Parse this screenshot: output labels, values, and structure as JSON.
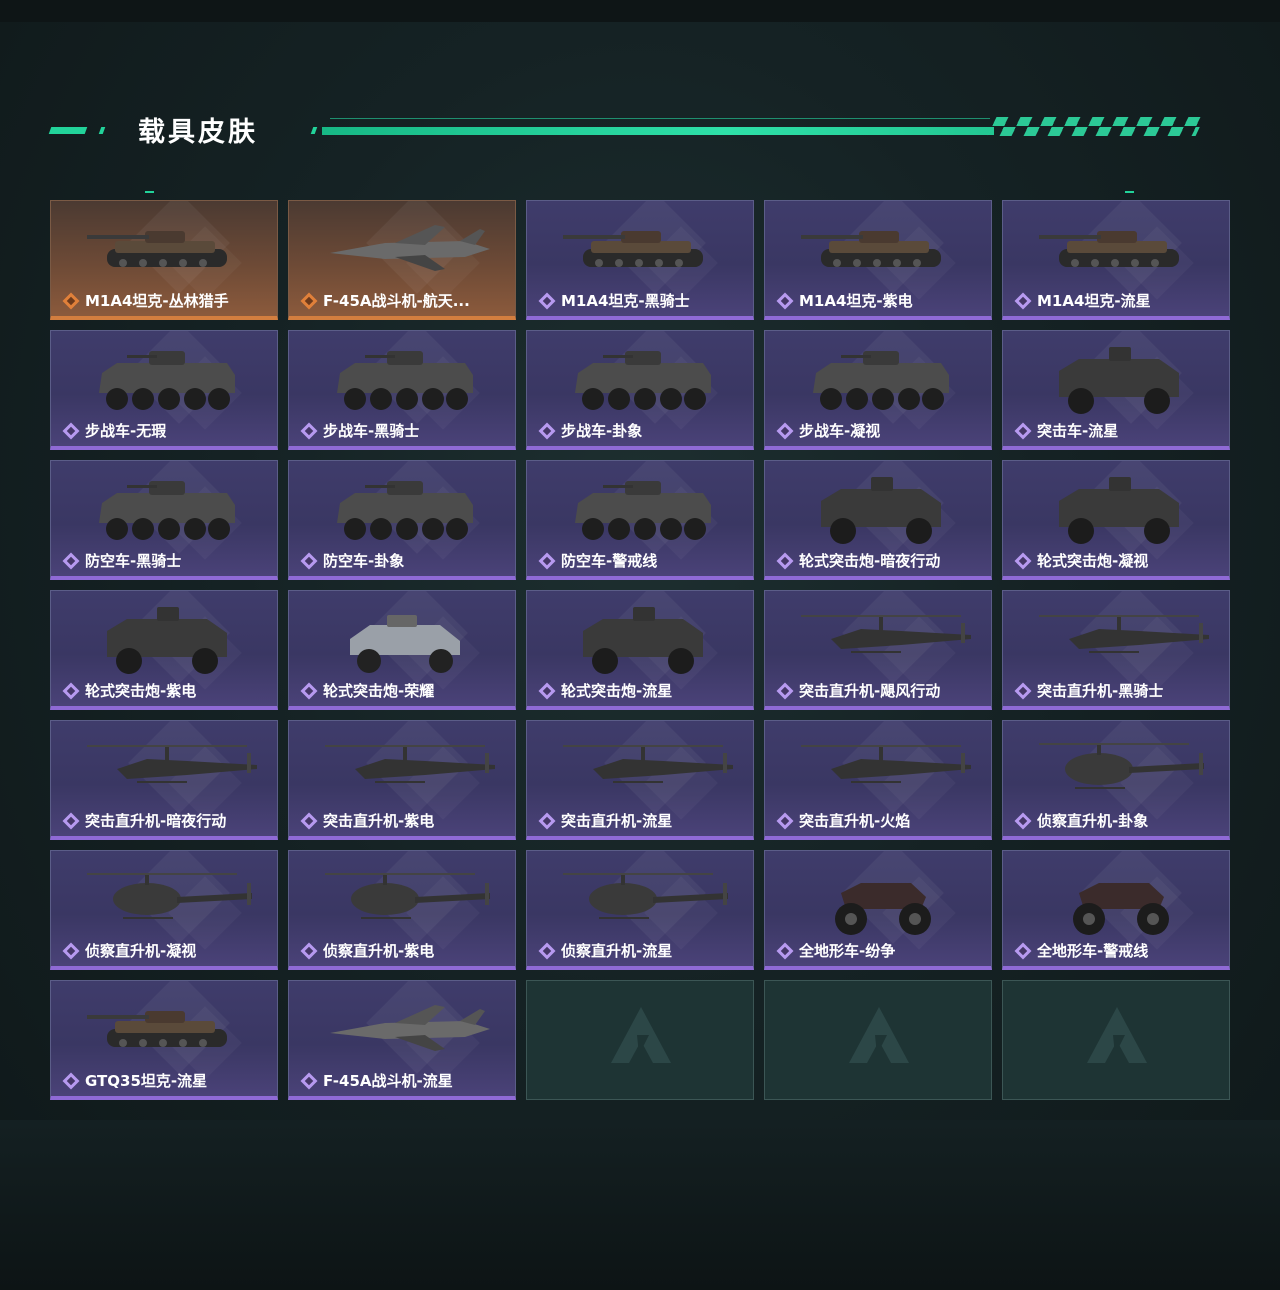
{
  "header": {
    "title": "载具皮肤"
  },
  "colors": {
    "accent": "#22d39a",
    "purple_rarity": "#8f6ad6",
    "orange_rarity": "#d37e3f"
  },
  "skins": [
    {
      "label": "M1A4坦克-丛林猎手",
      "rarity": "orange",
      "kind": "tank"
    },
    {
      "label": "F-45A战斗机-航天...",
      "rarity": "orange",
      "kind": "jet"
    },
    {
      "label": "M1A4坦克-黑骑士",
      "rarity": "purple",
      "kind": "tank"
    },
    {
      "label": "M1A4坦克-紫电",
      "rarity": "purple",
      "kind": "tank"
    },
    {
      "label": "M1A4坦克-流星",
      "rarity": "purple",
      "kind": "tank"
    },
    {
      "label": "步战车-无瑕",
      "rarity": "purple",
      "kind": "ifv"
    },
    {
      "label": "步战车-黑骑士",
      "rarity": "purple",
      "kind": "ifv"
    },
    {
      "label": "步战车-卦象",
      "rarity": "purple",
      "kind": "ifv"
    },
    {
      "label": "步战车-凝视",
      "rarity": "purple",
      "kind": "ifv"
    },
    {
      "label": "突击车-流星",
      "rarity": "purple",
      "kind": "truck"
    },
    {
      "label": "防空车-黑骑士",
      "rarity": "purple",
      "kind": "ifv"
    },
    {
      "label": "防空车-卦象",
      "rarity": "purple",
      "kind": "ifv"
    },
    {
      "label": "防空车-警戒线",
      "rarity": "purple",
      "kind": "ifv"
    },
    {
      "label": "轮式突击炮-暗夜行动",
      "rarity": "purple",
      "kind": "truck"
    },
    {
      "label": "轮式突击炮-凝视",
      "rarity": "purple",
      "kind": "truck"
    },
    {
      "label": "轮式突击炮-紫电",
      "rarity": "purple",
      "kind": "truck"
    },
    {
      "label": "轮式突击炮-荣耀",
      "rarity": "purple",
      "kind": "buggy"
    },
    {
      "label": "轮式突击炮-流星",
      "rarity": "purple",
      "kind": "truck"
    },
    {
      "label": "突击直升机-飓风行动",
      "rarity": "purple",
      "kind": "heli"
    },
    {
      "label": "突击直升机-黑骑士",
      "rarity": "purple",
      "kind": "heli"
    },
    {
      "label": "突击直升机-暗夜行动",
      "rarity": "purple",
      "kind": "heli"
    },
    {
      "label": "突击直升机-紫电",
      "rarity": "purple",
      "kind": "heli"
    },
    {
      "label": "突击直升机-流星",
      "rarity": "purple",
      "kind": "heli"
    },
    {
      "label": "突击直升机-火焰",
      "rarity": "purple",
      "kind": "heli"
    },
    {
      "label": "侦察直升机-卦象",
      "rarity": "purple",
      "kind": "scout"
    },
    {
      "label": "侦察直升机-凝视",
      "rarity": "purple",
      "kind": "scout"
    },
    {
      "label": "侦察直升机-紫电",
      "rarity": "purple",
      "kind": "scout"
    },
    {
      "label": "侦察直升机-流星",
      "rarity": "purple",
      "kind": "scout"
    },
    {
      "label": "全地形车-纷争",
      "rarity": "purple",
      "kind": "atv"
    },
    {
      "label": "全地形车-警戒线",
      "rarity": "purple",
      "kind": "atv"
    },
    {
      "label": "GTQ35坦克-流星",
      "rarity": "purple",
      "kind": "tank"
    },
    {
      "label": "F-45A战斗机-流星",
      "rarity": "purple",
      "kind": "jet"
    }
  ],
  "empty_slots": 3
}
